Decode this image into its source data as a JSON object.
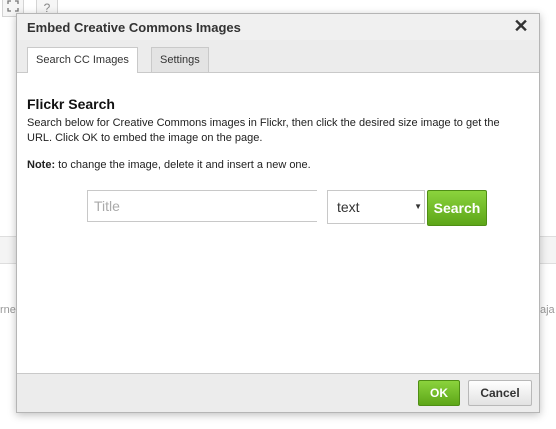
{
  "background": {
    "left_fragment": "rne",
    "right_fragment": "aja"
  },
  "dialog": {
    "title": "Embed Creative Commons Images",
    "close_glyph": "✕",
    "tabs": [
      {
        "label": "Search CC Images",
        "active": true
      },
      {
        "label": "Settings",
        "active": false
      }
    ],
    "heading": "Flickr Search",
    "description": "Search below for Creative Commons images in Flickr, then click the desired size image to get the URL. Click OK to embed the image on the page.",
    "note_label": "Note:",
    "note_text": " to change the image, delete it and insert a new one.",
    "search": {
      "placeholder": "Title",
      "type_value": "text",
      "button_label": "Search"
    },
    "footer": {
      "ok_label": "OK",
      "cancel_label": "Cancel"
    }
  },
  "colors": {
    "accent_green": "#6dbb21",
    "dialog_border": "#b5b5b5"
  },
  "icons": [
    "fullscreen-icon",
    "help-icon",
    "close-icon",
    "caret-down-icon"
  ]
}
